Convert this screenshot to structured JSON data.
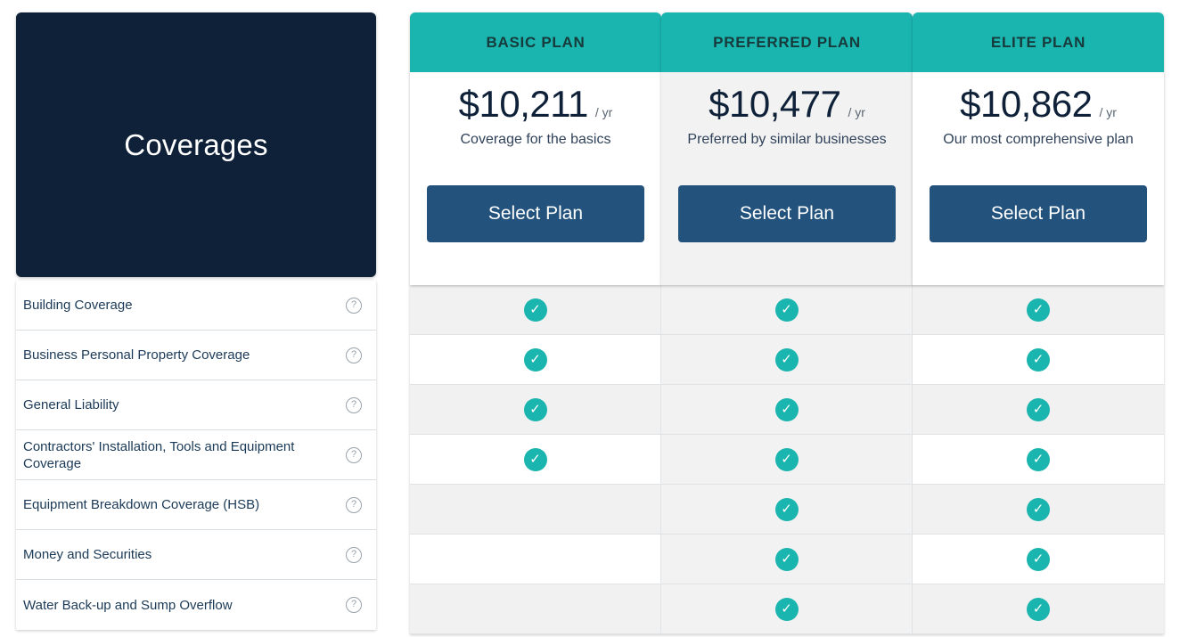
{
  "left_panel": {
    "title": "Coverages",
    "help_icon_glyph": "?",
    "coverages": [
      {
        "label": "Building Coverage"
      },
      {
        "label": "Business Personal Property Coverage"
      },
      {
        "label": "General Liability"
      },
      {
        "label": "Contractors' Installation, Tools and Equipment Coverage"
      },
      {
        "label": "Equipment Breakdown Coverage (HSB)"
      },
      {
        "label": "Money and Securities"
      },
      {
        "label": "Water Back-up and Sump Overflow"
      }
    ]
  },
  "plans": [
    {
      "name": "BASIC PLAN",
      "price": "$10,211",
      "period": "/ yr",
      "tagline": "Coverage for the basics",
      "cta": "Select Plan",
      "highlighted": false,
      "included": [
        true,
        true,
        true,
        true,
        false,
        false,
        false
      ]
    },
    {
      "name": "PREFERRED PLAN",
      "price": "$10,477",
      "period": "/ yr",
      "tagline": "Preferred by similar businesses",
      "cta": "Select Plan",
      "highlighted": true,
      "included": [
        true,
        true,
        true,
        true,
        true,
        true,
        true
      ]
    },
    {
      "name": "ELITE PLAN",
      "price": "$10,862",
      "period": "/ yr",
      "tagline": "Our most comprehensive plan",
      "cta": "Select Plan",
      "highlighted": false,
      "included": [
        true,
        true,
        true,
        true,
        true,
        true,
        true
      ]
    }
  ],
  "icons": {
    "check_glyph": "✓"
  },
  "colors": {
    "navy": "#0e2138",
    "teal": "#1bb5b0",
    "button_blue": "#23537d",
    "stripe": "#f1f1f1",
    "shaded_column": "#f2f2f2"
  }
}
